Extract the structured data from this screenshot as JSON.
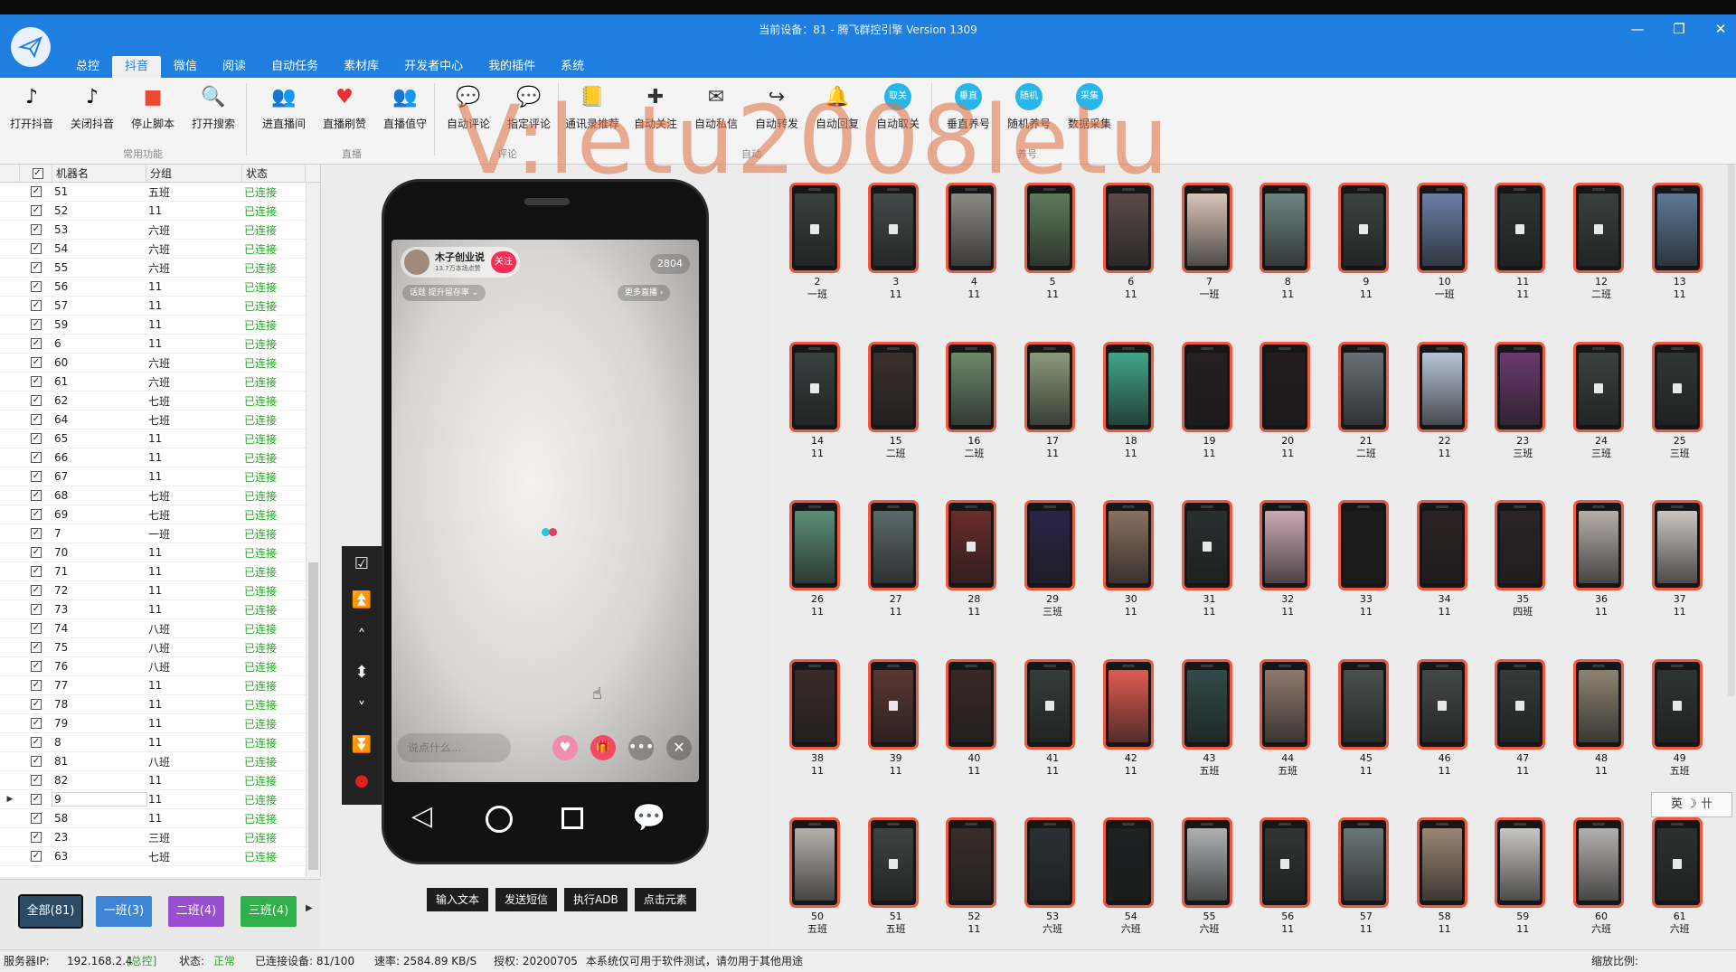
{
  "window": {
    "title": "当前设备：81 - 腾飞群控引擎 Version 1309",
    "minimize": "—",
    "restore": "❐",
    "close": "✕"
  },
  "menu": [
    {
      "label": "总控",
      "active": false
    },
    {
      "label": "抖音",
      "active": true
    },
    {
      "label": "微信",
      "active": false
    },
    {
      "label": "阅读",
      "active": false
    },
    {
      "label": "自动任务",
      "active": false
    },
    {
      "label": "素材库",
      "active": false
    },
    {
      "label": "开发者中心",
      "active": false
    },
    {
      "label": "我的插件",
      "active": false
    },
    {
      "label": "系统",
      "active": false
    }
  ],
  "toolbar": {
    "buttons": [
      {
        "label": "打开抖音",
        "icon": "douyin-icon",
        "glyph": "♪",
        "color": "#111111"
      },
      {
        "label": "关闭抖音",
        "icon": "douyin-close-icon",
        "glyph": "♪",
        "color": "#111111"
      },
      {
        "label": "停止脚本",
        "icon": "stop-icon",
        "glyph": "■",
        "color": "#e94a36"
      },
      {
        "label": "打开搜索",
        "icon": "search-icon",
        "glyph": "🔍",
        "color": "#333333"
      },
      {
        "label": "进直播间",
        "icon": "live-room-icon",
        "glyph": "👥",
        "color": "#333333"
      },
      {
        "label": "直播刷赞",
        "icon": "heart-icon",
        "glyph": "♥",
        "color": "#e83030"
      },
      {
        "label": "直播值守",
        "icon": "live-guard-icon",
        "glyph": "👥",
        "color": "#333333"
      },
      {
        "label": "自动评论",
        "icon": "comment-icon",
        "glyph": "💬",
        "color": "#333333"
      },
      {
        "label": "指定评论",
        "icon": "chat-bubble-icon",
        "glyph": "💬",
        "color": "#2b78d8"
      },
      {
        "label": "通讯录推荐",
        "icon": "contacts-icon",
        "glyph": "📒",
        "color": "#a26a2a"
      },
      {
        "label": "自动关注",
        "icon": "follow-icon",
        "glyph": "✚",
        "color": "#333333"
      },
      {
        "label": "自动私信",
        "icon": "mail-icon",
        "glyph": "✉",
        "color": "#333333"
      },
      {
        "label": "自动转发",
        "icon": "share-icon",
        "glyph": "↪",
        "color": "#333333"
      },
      {
        "label": "自动回复",
        "icon": "bell-icon",
        "glyph": "🔔",
        "color": "#333333"
      },
      {
        "label": "自动取关",
        "icon": "unfollow-icon",
        "glyph": "取关",
        "color": "#27b5ea"
      },
      {
        "label": "垂直养号",
        "icon": "vertical-nurture-icon",
        "glyph": "垂直",
        "color": "#27b5ea"
      },
      {
        "label": "随机养号",
        "icon": "random-nurture-icon",
        "glyph": "随机",
        "color": "#27b5ea"
      },
      {
        "label": "数据采集",
        "icon": "data-collect-icon",
        "glyph": "采集",
        "color": "#27b5ea"
      }
    ],
    "groups": [
      {
        "label": "常用功能"
      },
      {
        "label": "直播"
      },
      {
        "label": "评论"
      },
      {
        "label": "自动"
      },
      {
        "label": "养号"
      }
    ]
  },
  "device_list": {
    "headers": {
      "name": "机器名",
      "group": "分组",
      "status": "状态"
    },
    "rows": [
      {
        "name": "51",
        "group": "五班",
        "status": "已连接"
      },
      {
        "name": "52",
        "group": "11",
        "status": "已连接"
      },
      {
        "name": "53",
        "group": "六班",
        "status": "已连接"
      },
      {
        "name": "54",
        "group": "六班",
        "status": "已连接"
      },
      {
        "name": "55",
        "group": "六班",
        "status": "已连接"
      },
      {
        "name": "56",
        "group": "11",
        "status": "已连接"
      },
      {
        "name": "57",
        "group": "11",
        "status": "已连接"
      },
      {
        "name": "59",
        "group": "11",
        "status": "已连接"
      },
      {
        "name": "6",
        "group": "11",
        "status": "已连接"
      },
      {
        "name": "60",
        "group": "六班",
        "status": "已连接"
      },
      {
        "name": "61",
        "group": "六班",
        "status": "已连接"
      },
      {
        "name": "62",
        "group": "七班",
        "status": "已连接"
      },
      {
        "name": "64",
        "group": "七班",
        "status": "已连接"
      },
      {
        "name": "65",
        "group": "11",
        "status": "已连接"
      },
      {
        "name": "66",
        "group": "11",
        "status": "已连接"
      },
      {
        "name": "67",
        "group": "11",
        "status": "已连接"
      },
      {
        "name": "68",
        "group": "七班",
        "status": "已连接"
      },
      {
        "name": "69",
        "group": "七班",
        "status": "已连接"
      },
      {
        "name": "7",
        "group": "一班",
        "status": "已连接"
      },
      {
        "name": "70",
        "group": "11",
        "status": "已连接"
      },
      {
        "name": "71",
        "group": "11",
        "status": "已连接"
      },
      {
        "name": "72",
        "group": "11",
        "status": "已连接"
      },
      {
        "name": "73",
        "group": "11",
        "status": "已连接"
      },
      {
        "name": "74",
        "group": "八班",
        "status": "已连接"
      },
      {
        "name": "75",
        "group": "八班",
        "status": "已连接"
      },
      {
        "name": "76",
        "group": "八班",
        "status": "已连接"
      },
      {
        "name": "77",
        "group": "11",
        "status": "已连接"
      },
      {
        "name": "78",
        "group": "11",
        "status": "已连接"
      },
      {
        "name": "79",
        "group": "11",
        "status": "已连接"
      },
      {
        "name": "8",
        "group": "11",
        "status": "已连接"
      },
      {
        "name": "81",
        "group": "八班",
        "status": "已连接"
      },
      {
        "name": "82",
        "group": "11",
        "status": "已连接"
      },
      {
        "name": "9",
        "group": "11",
        "status": "已连接",
        "selected": true
      },
      {
        "name": "58",
        "group": "11",
        "status": "已连接"
      },
      {
        "name": "23",
        "group": "三班",
        "status": "已连接"
      },
      {
        "name": "63",
        "group": "七班",
        "status": "已连接"
      }
    ]
  },
  "group_buttons": [
    {
      "label": "全部(81)",
      "color": "#2b4a66"
    },
    {
      "label": "一班(3)",
      "color": "#3d86d6"
    },
    {
      "label": "二班(4)",
      "color": "#9a4fd0"
    },
    {
      "label": "三班(4)",
      "color": "#2fb04a"
    }
  ],
  "phone": {
    "streamer_name": "木子创业说",
    "streamer_sub": "13.7万本场点赞",
    "follow": "关注",
    "viewers": "2804",
    "topic": "话题 提升留存率 ⌄",
    "more_live": "更多直播 ›",
    "comment_placeholder": "说点什么..."
  },
  "side_controls": [
    {
      "name": "checkbox-icon",
      "glyph": "☑"
    },
    {
      "name": "double-up-icon",
      "glyph": "⏫"
    },
    {
      "name": "up-icon",
      "glyph": "˄"
    },
    {
      "name": "up-down-icon",
      "glyph": "⬍"
    },
    {
      "name": "down-icon",
      "glyph": "˅"
    },
    {
      "name": "double-down-icon",
      "glyph": "⏬"
    },
    {
      "name": "record-icon",
      "glyph": "●"
    }
  ],
  "actions": [
    {
      "label": "输入文本"
    },
    {
      "label": "发送短信"
    },
    {
      "label": "执行ADB"
    },
    {
      "label": "点击元素"
    }
  ],
  "grid_devices": [
    {
      "id": "2",
      "group": "一班",
      "screen": "#3b3f3e",
      "play": true
    },
    {
      "id": "3",
      "group": "11",
      "screen": "#454949",
      "play": true
    },
    {
      "id": "4",
      "group": "11",
      "screen": "#8b8a86",
      "play": false
    },
    {
      "id": "5",
      "group": "11",
      "screen": "#5d7a5a",
      "play": false
    },
    {
      "id": "6",
      "group": "11",
      "screen": "#5a4a4a",
      "play": false
    },
    {
      "id": "7",
      "group": "一班",
      "screen": "#d8c4b8",
      "play": false
    },
    {
      "id": "8",
      "group": "11",
      "screen": "#6f8582",
      "play": false
    },
    {
      "id": "9",
      "group": "11",
      "screen": "#3c4241",
      "play": true
    },
    {
      "id": "10",
      "group": "一班",
      "screen": "#6b7fa8",
      "play": false
    },
    {
      "id": "11",
      "group": "11",
      "screen": "#2f3433",
      "play": true
    },
    {
      "id": "12",
      "group": "二班",
      "screen": "#3a3f3e",
      "play": true
    },
    {
      "id": "13",
      "group": "11",
      "screen": "#5d7896",
      "play": false
    },
    {
      "id": "14",
      "group": "11",
      "screen": "#3a3f3f",
      "play": true
    },
    {
      "id": "15",
      "group": "二班",
      "screen": "#3c2f2f",
      "play": false
    },
    {
      "id": "16",
      "group": "二班",
      "screen": "#6e8a6c",
      "play": false
    },
    {
      "id": "17",
      "group": "11",
      "screen": "#8a9b7a",
      "play": false
    },
    {
      "id": "18",
      "group": "11",
      "screen": "#3fa58a",
      "play": false
    },
    {
      "id": "19",
      "group": "11",
      "screen": "#241f22",
      "play": false
    },
    {
      "id": "20",
      "group": "11",
      "screen": "#241d1f",
      "play": false
    },
    {
      "id": "21",
      "group": "二班",
      "screen": "#6b6f76",
      "play": false
    },
    {
      "id": "22",
      "group": "11",
      "screen": "#b7c3d6",
      "play": false
    },
    {
      "id": "23",
      "group": "三班",
      "screen": "#6a3a6e",
      "play": false
    },
    {
      "id": "24",
      "group": "三班",
      "screen": "#3c403f",
      "play": true
    },
    {
      "id": "25",
      "group": "三班",
      "screen": "#303534",
      "play": true
    },
    {
      "id": "26",
      "group": "11",
      "screen": "#5a8e78",
      "play": false
    },
    {
      "id": "27",
      "group": "11",
      "screen": "#5b6a6c",
      "play": false
    },
    {
      "id": "28",
      "group": "11",
      "screen": "#6a2b2b",
      "play": true
    },
    {
      "id": "29",
      "group": "三班",
      "screen": "#2a2448",
      "play": false
    },
    {
      "id": "30",
      "group": "11",
      "screen": "#8a7060",
      "play": false
    },
    {
      "id": "31",
      "group": "11",
      "screen": "#2a2f2f",
      "play": true
    },
    {
      "id": "32",
      "group": "11",
      "screen": "#c9a9b4",
      "play": false
    },
    {
      "id": "33",
      "group": "11",
      "screen": "#1c1c1c",
      "play": false
    },
    {
      "id": "34",
      "group": "11",
      "screen": "#2d2224",
      "play": false
    },
    {
      "id": "35",
      "group": "四班",
      "screen": "#2a2526",
      "play": false
    },
    {
      "id": "36",
      "group": "11",
      "screen": "#b8aea8",
      "play": false
    },
    {
      "id": "37",
      "group": "11",
      "screen": "#c9c5c0",
      "play": false
    },
    {
      "id": "38",
      "group": "11",
      "screen": "#3a2a2a",
      "play": false
    },
    {
      "id": "39",
      "group": "11",
      "screen": "#5a3632",
      "play": true
    },
    {
      "id": "40",
      "group": "11",
      "screen": "#3a2828",
      "play": false
    },
    {
      "id": "41",
      "group": "11",
      "screen": "#363b3a",
      "play": true
    },
    {
      "id": "42",
      "group": "11",
      "screen": "#e25a52",
      "play": false
    },
    {
      "id": "43",
      "group": "五班",
      "screen": "#2f4a4a",
      "play": false
    },
    {
      "id": "44",
      "group": "五班",
      "screen": "#8e7a6e",
      "play": false
    },
    {
      "id": "45",
      "group": "11",
      "screen": "#4a4f4e",
      "play": false
    },
    {
      "id": "46",
      "group": "11",
      "screen": "#444847",
      "play": true
    },
    {
      "id": "47",
      "group": "11",
      "screen": "#353a39",
      "play": true
    },
    {
      "id": "48",
      "group": "11",
      "screen": "#8e8272",
      "play": false
    },
    {
      "id": "49",
      "group": "五班",
      "screen": "#2f3433",
      "play": true
    },
    {
      "id": "50",
      "group": "五班",
      "screen": "#b5b0aa",
      "play": false
    },
    {
      "id": "51",
      "group": "五班",
      "screen": "#3d4241",
      "play": true
    },
    {
      "id": "52",
      "group": "11",
      "screen": "#3a2d2c",
      "play": false
    },
    {
      "id": "53",
      "group": "六班",
      "screen": "#2c3036",
      "play": false
    },
    {
      "id": "54",
      "group": "六班",
      "screen": "#1e2222",
      "play": false
    },
    {
      "id": "55",
      "group": "六班",
      "screen": "#aeb0b2",
      "play": false
    },
    {
      "id": "56",
      "group": "11",
      "screen": "#303534",
      "play": true
    },
    {
      "id": "57",
      "group": "11",
      "screen": "#6a7676",
      "play": false
    },
    {
      "id": "58",
      "group": "11",
      "screen": "#9a8574",
      "play": false
    },
    {
      "id": "59",
      "group": "11",
      "screen": "#c8c6c2",
      "play": false
    },
    {
      "id": "60",
      "group": "六班",
      "screen": "#b4b2b0",
      "play": false
    },
    {
      "id": "61",
      "group": "六班",
      "screen": "#2c3130",
      "play": true
    }
  ],
  "ime": "英 ☽ 卄",
  "status_bar": {
    "server_label": "服务器IP:",
    "server_ip": "192.168.2.4",
    "server_role": "[总控]",
    "status_label": "状态:",
    "status_value": "正常",
    "connected": "已连接设备: 81/100",
    "rate": "速率: 2584.89 KB/S",
    "license": "授权: 20200705",
    "notice": "本系统仅可用于软件测试，请勿用于其他用途",
    "zoom": "缩放比例:"
  },
  "watermark": "V:letu2008letu"
}
